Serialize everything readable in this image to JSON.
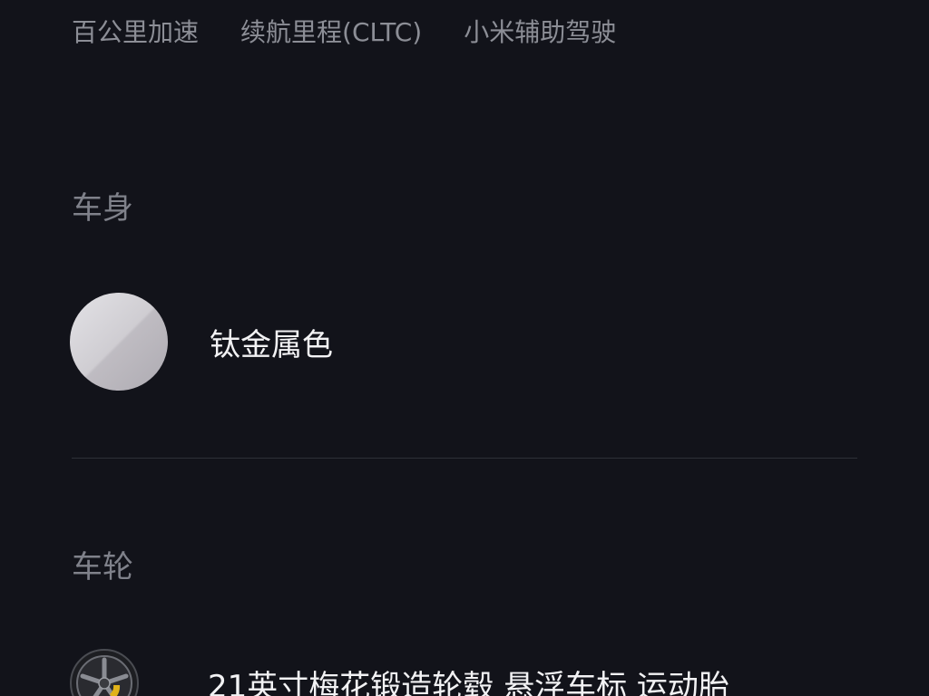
{
  "spec_bar": {
    "items": [
      "百公里加速",
      "续航里程(CLTC)",
      "小米辅助驾驶"
    ]
  },
  "sections": {
    "body": {
      "title": "车身",
      "option_label": "钛金属色",
      "swatch_color": "#c9c7cc"
    },
    "wheels": {
      "title": "车轮",
      "option_label": "21英寸梅花锻造轮毂 悬浮车标 运动胎",
      "caliper_color": "#e0b21a"
    }
  },
  "icons": {
    "body_swatch": "color-swatch-icon",
    "wheel": "wheel-icon"
  }
}
